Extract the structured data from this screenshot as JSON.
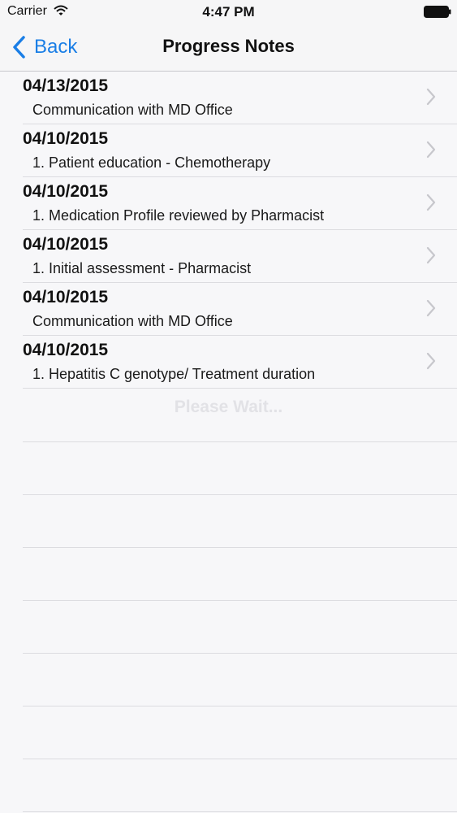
{
  "status_bar": {
    "carrier": "Carrier",
    "time": "4:47 PM",
    "wifi_icon": "wifi-icon",
    "battery_icon": "battery-icon"
  },
  "nav": {
    "back_label": "Back",
    "title": "Progress Notes",
    "accent_color": "#1a7ee6"
  },
  "notes": [
    {
      "date": "04/13/2015",
      "description": "Communication with MD Office"
    },
    {
      "date": "04/10/2015",
      "description": "1. Patient education - Chemotherapy"
    },
    {
      "date": "04/10/2015",
      "description": "1. Medication Profile reviewed by Pharmacist"
    },
    {
      "date": "04/10/2015",
      "description": "1. Initial assessment - Pharmacist"
    },
    {
      "date": "04/10/2015",
      "description": "Communication with MD Office"
    },
    {
      "date": "04/10/2015",
      "description": "1. Hepatitis C genotype/ Treatment duration"
    }
  ],
  "loading": {
    "text": "Please Wait..."
  }
}
